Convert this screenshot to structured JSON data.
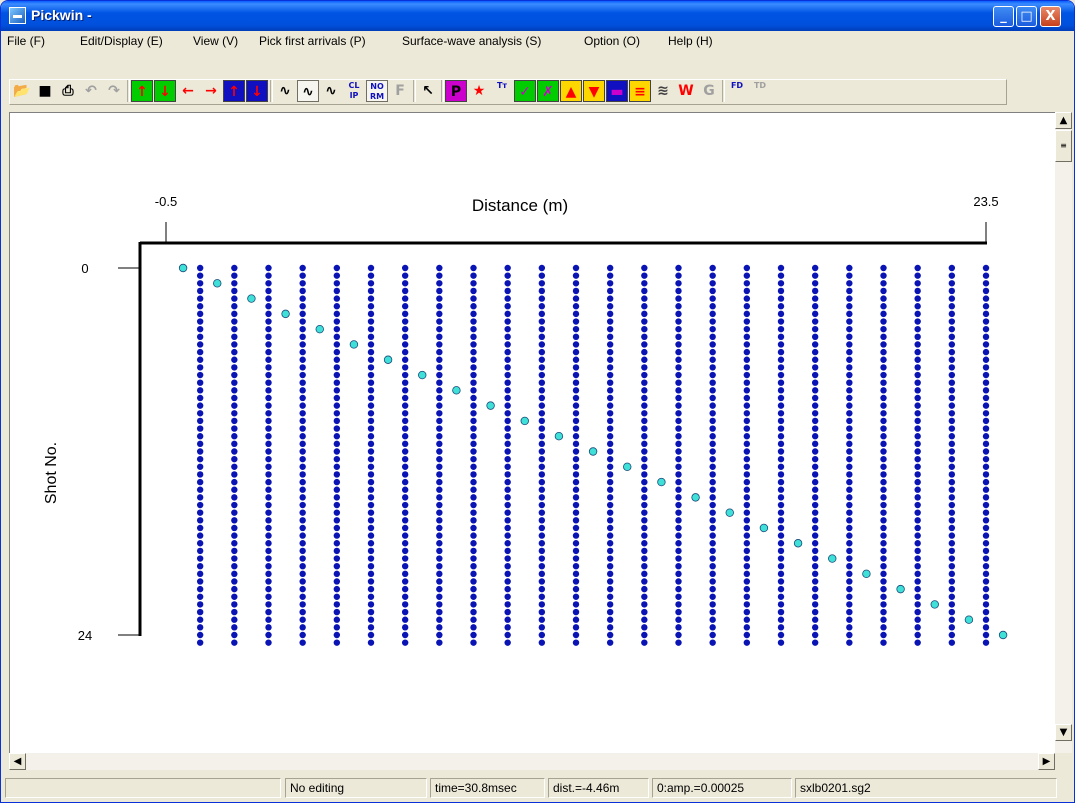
{
  "window": {
    "title": "Pickwin -"
  },
  "window_controls": {
    "minimize": "_",
    "maximize": "□",
    "close": "X"
  },
  "menu": [
    "File (F)",
    "Edit/Display (E)",
    "View (V)",
    "Pick first arrivals (P)",
    "Surface-wave analysis (S)",
    "Option (O)",
    "Help (H)"
  ],
  "toolbar": {
    "buttons": [
      {
        "name": "open-icon",
        "glyph": "📂",
        "color": "#c8a000"
      },
      {
        "name": "save-icon",
        "glyph": "■",
        "color": "#000000"
      },
      {
        "name": "print-icon",
        "glyph": "⎙",
        "color": "#000000"
      },
      {
        "name": "undo-icon",
        "glyph": "↶",
        "color": "#a0a0a0"
      },
      {
        "name": "redo-icon",
        "glyph": "↷",
        "color": "#a0a0a0"
      },
      {
        "name": "arrow-up-icon",
        "glyph": "↑",
        "color": "#ff0000",
        "bg": "#00cc00"
      },
      {
        "name": "arrow-down-icon",
        "glyph": "↓",
        "color": "#ff0000",
        "bg": "#00cc00"
      },
      {
        "name": "arrow-left-icon",
        "glyph": "←",
        "color": "#ff0000"
      },
      {
        "name": "arrow-right-icon",
        "glyph": "→",
        "color": "#ff0000"
      },
      {
        "name": "bold-arrow-up-icon",
        "glyph": "↑",
        "color": "#ff0000",
        "bg": "#1010c0"
      },
      {
        "name": "bold-arrow-down-icon",
        "glyph": "↓",
        "color": "#ff0000",
        "bg": "#1010c0"
      },
      {
        "name": "wiggle-icon",
        "glyph": "∿",
        "color": "#000000"
      },
      {
        "name": "wiggle-fill-icon",
        "glyph": "∿",
        "color": "#000000",
        "pressed": true
      },
      {
        "name": "wiggle-variable-icon",
        "glyph": "∿",
        "color": "#000000"
      },
      {
        "name": "clip-icon",
        "glyph": "CL IP",
        "color": "#1010c0",
        "small": true
      },
      {
        "name": "normalize-icon",
        "glyph": "NO RM",
        "color": "#1010c0",
        "small": true,
        "pressed": true
      },
      {
        "name": "filter-icon",
        "glyph": "F",
        "color": "#a0a0a0"
      },
      {
        "name": "pointer-icon",
        "glyph": "↖",
        "color": "#000000"
      },
      {
        "name": "pick-icon",
        "glyph": "P",
        "color": "#000000",
        "bg": "#cc00cc"
      },
      {
        "name": "star-icon",
        "glyph": "★",
        "color": "#ff0000"
      },
      {
        "name": "traveltime-icon",
        "glyph": "Tт",
        "color": "#1010c0",
        "small": true
      },
      {
        "name": "check-icon",
        "glyph": "✓",
        "color": "#cc00cc",
        "bg": "#00cc00"
      },
      {
        "name": "cross-icon",
        "glyph": "✗",
        "color": "#cc00cc",
        "bg": "#00cc00"
      },
      {
        "name": "triangle-up-icon",
        "glyph": "▲",
        "color": "#ff0000",
        "bg": "#ffd700"
      },
      {
        "name": "triangle-down-icon",
        "glyph": "▼",
        "color": "#ff0000",
        "bg": "#ffd700"
      },
      {
        "name": "color-bar-icon",
        "glyph": "▬",
        "color": "#cc00cc",
        "bg": "#1010c0"
      },
      {
        "name": "color-stripes-icon",
        "glyph": "≡",
        "color": "#ff0000",
        "bg": "#ffd700"
      },
      {
        "name": "wave-icon",
        "glyph": "≋",
        "color": "#404040"
      },
      {
        "name": "w-icon",
        "glyph": "W",
        "color": "#ff0000"
      },
      {
        "name": "g-icon",
        "glyph": "G",
        "color": "#a0a0a0"
      },
      {
        "name": "fd-icon",
        "glyph": "FD",
        "color": "#1010c0",
        "small": true
      },
      {
        "name": "td-icon",
        "glyph": "TD",
        "color": "#a0a0a0",
        "small": true
      }
    ]
  },
  "chart_data": {
    "type": "scatter",
    "title": "",
    "xlabel": "Distance (m)",
    "ylabel": "Shot No.",
    "x_ticks": [
      "-0.5",
      "23.5"
    ],
    "y_ticks": [
      "0",
      "24"
    ],
    "xlim": [
      -0.5,
      23.5
    ],
    "ylim": [
      0,
      24
    ],
    "series": [
      {
        "name": "receivers",
        "color": "#0a14b4",
        "x": [
          0,
          1,
          2,
          3,
          4,
          5,
          6,
          7,
          8,
          9,
          10,
          11,
          12,
          13,
          14,
          15,
          16,
          17,
          18,
          19,
          20,
          21,
          22,
          23
        ],
        "rows_per_shot": 2,
        "shots": 25
      },
      {
        "name": "sources",
        "color": "#3ee0d8",
        "points": [
          [
            0,
            0
          ],
          [
            1,
            1
          ],
          [
            2,
            2
          ],
          [
            3,
            3
          ],
          [
            4,
            4
          ],
          [
            5,
            5
          ],
          [
            6,
            6
          ],
          [
            7,
            7
          ],
          [
            8,
            8
          ],
          [
            9,
            9
          ],
          [
            10,
            10
          ],
          [
            11,
            11
          ],
          [
            12,
            12
          ],
          [
            13,
            13
          ],
          [
            14,
            14
          ],
          [
            15,
            15
          ],
          [
            16,
            16
          ],
          [
            17,
            17
          ],
          [
            18,
            18
          ],
          [
            19,
            19
          ],
          [
            20,
            20
          ],
          [
            21,
            21
          ],
          [
            22,
            22
          ],
          [
            23,
            23
          ],
          [
            24,
            24
          ]
        ]
      }
    ]
  },
  "status": {
    "s0": "",
    "mode": "No editing",
    "time": "time=30.8msec",
    "dist": "dist.=-4.46m",
    "amp": "0:amp.=0.00025",
    "file": "sxlb0201.sg2"
  }
}
